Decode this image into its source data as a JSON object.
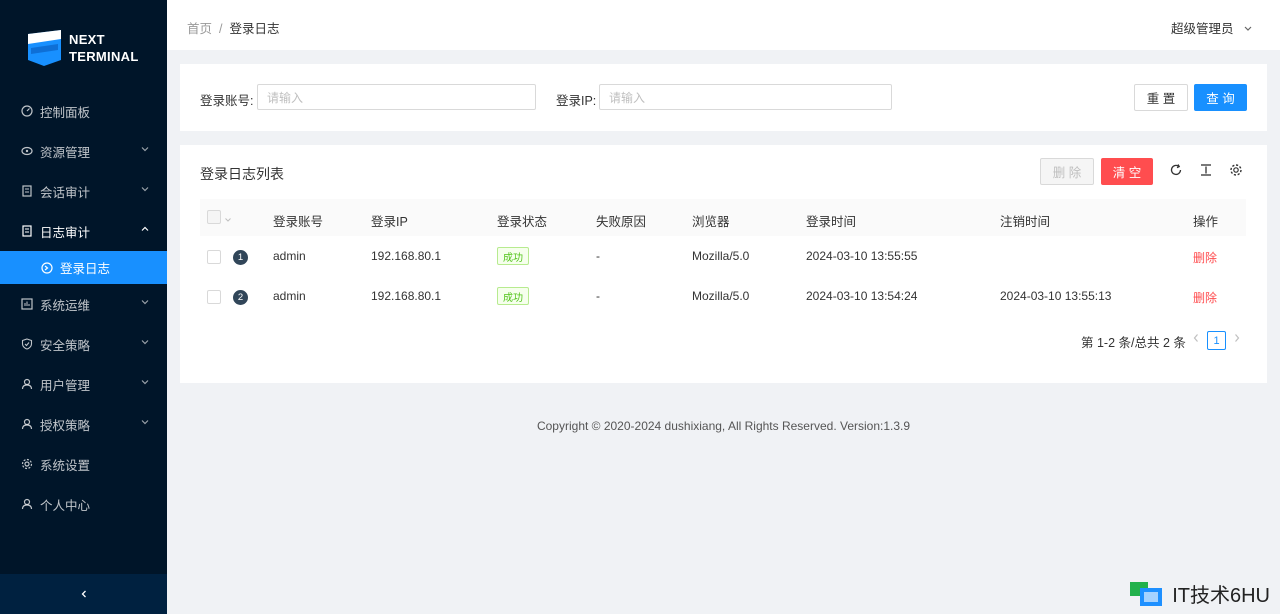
{
  "app": {
    "logo_line1": "NEXT",
    "logo_line2": "TERMINAL"
  },
  "sidebar": {
    "items": [
      {
        "label": "控制面板",
        "icon": "dashboard-icon",
        "has_arrow": false
      },
      {
        "label": "资源管理",
        "icon": "cloud-icon",
        "has_arrow": true
      },
      {
        "label": "会话审计",
        "icon": "audit-icon",
        "has_arrow": true
      },
      {
        "label": "日志审计",
        "icon": "log-icon",
        "has_arrow": true,
        "open": true
      },
      {
        "label": "系统运维",
        "icon": "ops-icon",
        "has_arrow": true
      },
      {
        "label": "安全策略",
        "icon": "shield-icon",
        "has_arrow": true
      },
      {
        "label": "用户管理",
        "icon": "user-icon",
        "has_arrow": true
      },
      {
        "label": "授权策略",
        "icon": "user-icon",
        "has_arrow": true
      },
      {
        "label": "系统设置",
        "icon": "gear-icon",
        "has_arrow": false
      },
      {
        "label": "个人中心",
        "icon": "user-icon",
        "has_arrow": false
      }
    ],
    "active_sub": {
      "label": "登录日志",
      "icon": "login-log-icon"
    },
    "collapse_glyph": "<"
  },
  "header": {
    "breadcrumb_home": "首页",
    "breadcrumb_sep": "/",
    "breadcrumb_current": "登录日志",
    "user": "超级管理员"
  },
  "search": {
    "account_label": "登录账号:",
    "account_placeholder": "请输入",
    "ip_label": "登录IP:",
    "ip_placeholder": "请输入",
    "reset_label": "重 置",
    "query_label": "查 询"
  },
  "table": {
    "title": "登录日志列表",
    "delete_label": "删 除",
    "clear_label": "清 空",
    "columns": [
      "登录账号",
      "登录IP",
      "登录状态",
      "失败原因",
      "浏览器",
      "登录时间",
      "注销时间",
      "操作"
    ],
    "rows": [
      {
        "index": "1",
        "account": "admin",
        "ip": "192.168.80.1",
        "status": "成功",
        "reason": "-",
        "browser": "Mozilla/5.0",
        "login_time": "2024-03-10 13:55:55",
        "logout_time": "",
        "action": "删除"
      },
      {
        "index": "2",
        "account": "admin",
        "ip": "192.168.80.1",
        "status": "成功",
        "reason": "-",
        "browser": "Mozilla/5.0",
        "login_time": "2024-03-10 13:54:24",
        "logout_time": "2024-03-10 13:55:13",
        "action": "删除"
      }
    ],
    "pagination_text": "第 1-2 条/总共 2 条",
    "current_page": "1"
  },
  "footer": {
    "copyright": "Copyright © 2020-2024 dushixiang, All Rights Reserved. Version:1.3.9"
  },
  "watermark": {
    "text": "IT技术6HU"
  },
  "colors": {
    "sidebar_bg": "#001529",
    "primary": "#1890ff",
    "danger": "#ff4d4f",
    "success": "#52c41a"
  }
}
